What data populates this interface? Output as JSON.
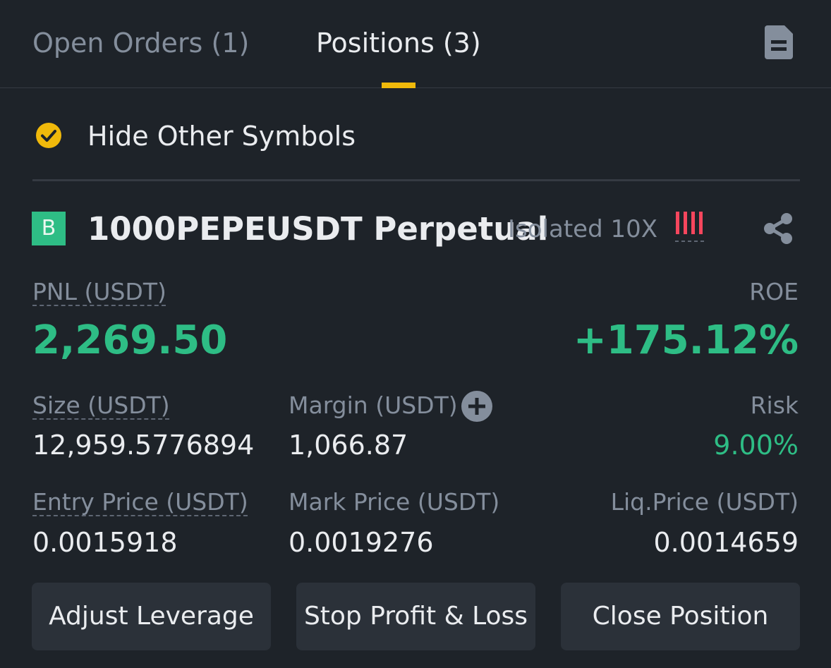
{
  "tabs": {
    "open_orders": "Open Orders (1)",
    "positions": "Positions (3)"
  },
  "filter": {
    "label": "Hide Other Symbols",
    "checked": true
  },
  "position": {
    "side_badge": "B",
    "symbol": "1000PEPEUSDT Perpetual",
    "margin_mode": "Isolated 10X",
    "pnl_label": "PNL (USDT)",
    "pnl_value": "2,269.50",
    "roe_label": "ROE",
    "roe_value": "+175.12%",
    "size_label": "Size (USDT)",
    "size_value": "12,959.5776894",
    "margin_label": "Margin (USDT)",
    "margin_value": "1,066.87",
    "risk_label": "Risk",
    "risk_value": "9.00%",
    "entry_label": "Entry Price (USDT)",
    "entry_value": "0.0015918",
    "mark_label": "Mark Price (USDT)",
    "mark_value": "0.0019276",
    "liq_label": "Liq.Price (USDT)",
    "liq_value": "0.0014659"
  },
  "buttons": {
    "adjust_leverage": "Adjust Leverage",
    "stop_profit_loss": "Stop Profit & Loss",
    "close_position": "Close Position"
  },
  "colors": {
    "background": "#1e2329",
    "accent": "#f0b90b",
    "profit_green": "#2ebd85",
    "risk_red": "#f6465d",
    "muted_text": "#848e9c",
    "button_bg": "#2b3139"
  },
  "icons": {
    "document": "document-icon",
    "check": "check-circle-icon",
    "risk": "risk-bars-icon",
    "share": "share-icon",
    "add": "plus-circle-icon"
  }
}
